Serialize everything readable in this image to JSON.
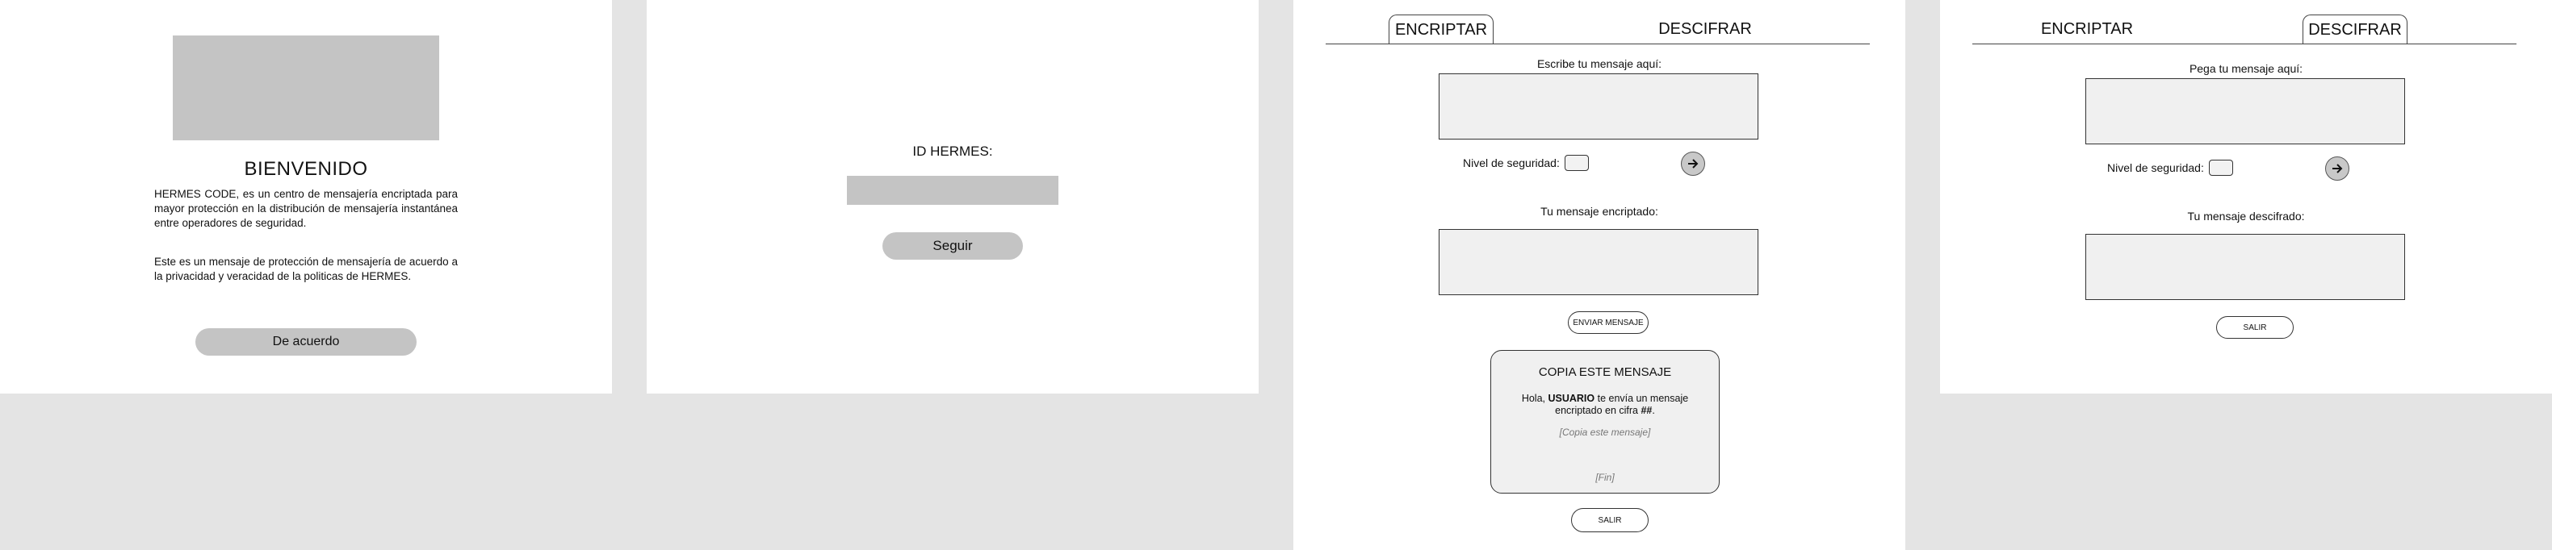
{
  "welcome": {
    "title": "BIENVENIDO",
    "paragraph1": "HERMES CODE, es un centro de mensajería encriptada para mayor protección en la distribución de mensajería instantánea entre operadores de seguridad.",
    "paragraph2": "Este es un mensaje de protección de mensajería de acuerdo a la privacidad y veracidad de la politicas de HERMES.",
    "agree_label": "De acuerdo"
  },
  "login": {
    "id_label": "ID HERMES:",
    "id_value": "",
    "continue_label": "Seguir"
  },
  "encrypt_screen": {
    "tabs": [
      {
        "label": "ENCRIPTAR",
        "active": true
      },
      {
        "label": "DESCIFRAR",
        "active": false
      }
    ],
    "input_label": "Escribe tu mensaje aquí:",
    "security_label": "Nivel de seguridad:",
    "output_label": "Tu mensaje encriptado:",
    "send_label": "ENVIAR MENSAJE",
    "card": {
      "title": "COPIA ESTE MENSAJE",
      "greeting_prefix": "Hola, ",
      "greeting_user": "USUARIO",
      "greeting_middle": " te envía un mensaje encriptado en cifra ",
      "greeting_cipher": "##",
      "greeting_suffix": ".",
      "placeholder": "[Copia este mensaje]",
      "end": "[Fin]"
    },
    "exit_label": "SALIR"
  },
  "decrypt_screen": {
    "tabs": [
      {
        "label": "ENCRIPTAR",
        "active": false
      },
      {
        "label": "DESCIFRAR",
        "active": true
      }
    ],
    "input_label": "Pega tu mensaje aquí:",
    "security_label": "Nivel de seguridad:",
    "output_label": "Tu mensaje descifrado:",
    "exit_label": "SALIR"
  },
  "icons": {
    "arrow": "arrow-right-icon"
  },
  "colors": {
    "canvas": "#e4e4e4",
    "panel": "#ffffff",
    "placeholder_gray": "#c4c4c4",
    "field_fill": "#f0f0f0"
  }
}
